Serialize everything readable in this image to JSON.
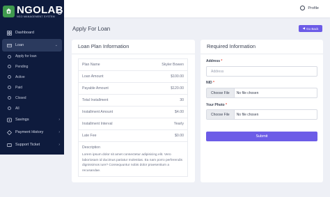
{
  "brand": {
    "name": "NGOLAB",
    "subtitle": "NGO MANAGEMENT SYSTEM"
  },
  "sidebar": {
    "items": [
      {
        "label": "Dashboard",
        "icon": "dashboard-icon"
      },
      {
        "label": "Loan",
        "icon": "loan-icon",
        "active": true
      },
      {
        "label": "Savings",
        "icon": "savings-icon"
      },
      {
        "label": "Payment History",
        "icon": "payment-history-icon"
      },
      {
        "label": "Support Ticket",
        "icon": "support-ticket-icon"
      }
    ],
    "loan_sub": [
      {
        "label": "Apply for loan"
      },
      {
        "label": "Pending"
      },
      {
        "label": "Active"
      },
      {
        "label": "Paid"
      },
      {
        "label": "Closed"
      },
      {
        "label": "All"
      }
    ]
  },
  "topbar": {
    "profile_label": "Profile"
  },
  "header": {
    "title": "Apply For Loan",
    "go_back_label": "Go Back"
  },
  "loan_plan": {
    "title": "Loan Plan Information",
    "rows": [
      {
        "label": "Plan Name",
        "value": "Skyler Bowen"
      },
      {
        "label": "Loan Amount",
        "value": "$100.00"
      },
      {
        "label": "Payable Amount",
        "value": "$120.00"
      },
      {
        "label": "Total Installment",
        "value": "30"
      },
      {
        "label": "Installment Amount",
        "value": "$4.00"
      },
      {
        "label": "Installment Interval",
        "value": "Yearly"
      },
      {
        "label": "Late Fee",
        "value": "$0.00"
      }
    ],
    "description_label": "Description",
    "description_text": "Lorem ipsum dolor sit amet consectetur adipisicing elit. Vero laboriosam id ducimus pariatur molestias. Ea nam porro perferendis dignissimos iure? Consequuntur nobis dolor praesentium a recusandae."
  },
  "required": {
    "title": "Required Information",
    "address_label": "Address",
    "address_placeholder": "Address",
    "nid_label": "NID",
    "photo_label": "Your Photo",
    "choose_file_label": "Choose File",
    "no_file_label": "No file chosen",
    "submit_label": "Submit"
  },
  "colors": {
    "sidebar_bg": "#0e1b3d",
    "accent": "#6c5ce7",
    "page_bg": "#eef0f6"
  }
}
